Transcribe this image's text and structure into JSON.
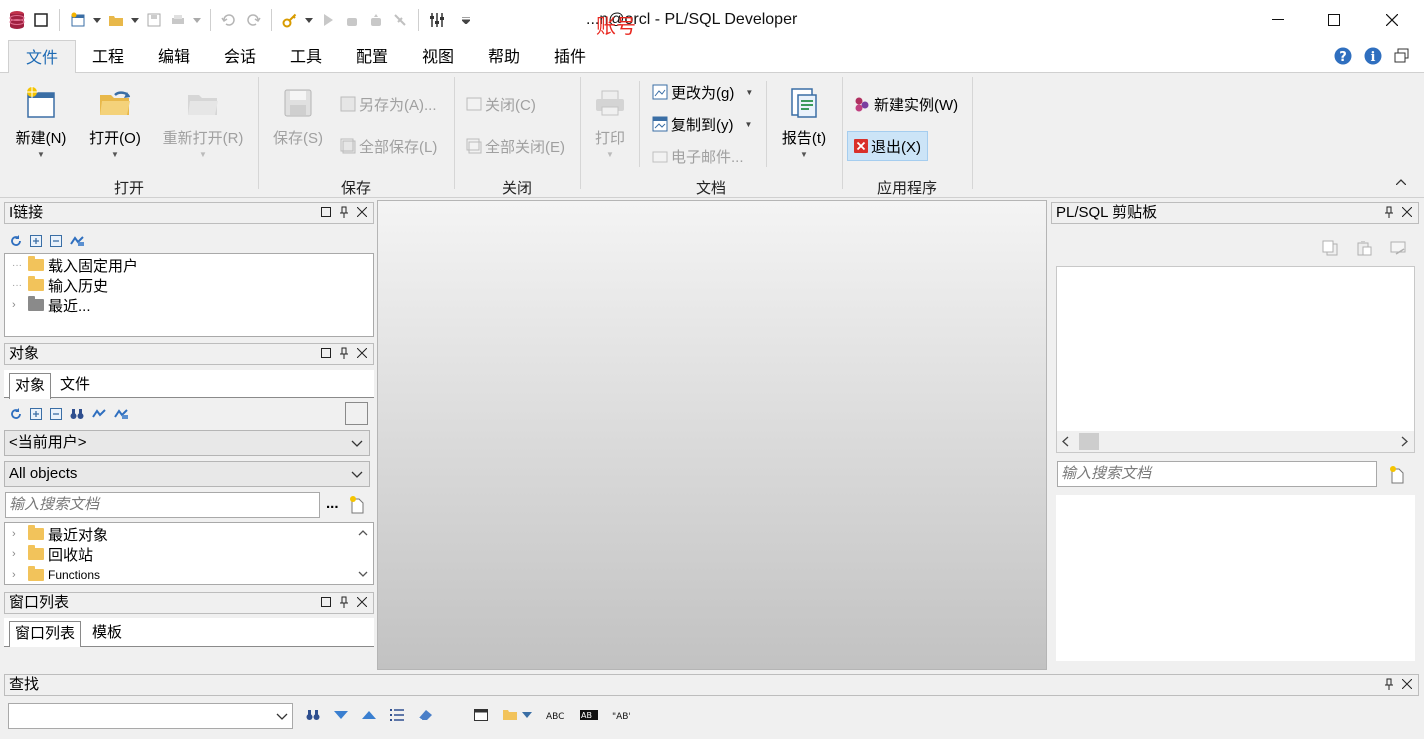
{
  "window": {
    "title_prefix": "...",
    "title_suffix": "n@orcl - PL/SQL Developer",
    "title_overlay": "账号"
  },
  "menu": [
    "文件",
    "工程",
    "编辑",
    "会话",
    "工具",
    "配置",
    "视图",
    "帮助",
    "插件"
  ],
  "ribbon": {
    "new": "新建(N)",
    "open": "打开(O)",
    "reopen": "重新打开(R)",
    "group_open": "打开",
    "save": "保存(S)",
    "save_as": "另存为(A)...",
    "save_all": "全部保存(L)",
    "group_save": "保存",
    "close": "关闭(C)",
    "close_all": "全部关闭(E)",
    "group_close": "关闭",
    "print": "打印",
    "change_to": "更改为(g)",
    "copy_to": "复制到(y)",
    "email": "电子邮件...",
    "report": "报告(t)",
    "group_doc": "文档",
    "new_instance": "新建实例(W)",
    "exit": "退出(X)",
    "group_app": "应用程序"
  },
  "connection_panel": {
    "title": "I链接",
    "items": [
      "载入固定用户",
      "输入历史",
      "最近..."
    ]
  },
  "object_panel": {
    "title": "对象",
    "tabs": [
      "对象",
      "文件"
    ],
    "user_combo": "<当前用户>",
    "filter_combo": "All objects",
    "search_placeholder": "输入搜索文档",
    "more": "...",
    "items": [
      "最近对象",
      "回收站",
      "Functions"
    ]
  },
  "window_list_panel": {
    "title": "窗口列表",
    "tabs": [
      "窗口列表",
      "模板"
    ]
  },
  "clipboard_panel": {
    "title": "PL/SQL 剪贴板",
    "search_placeholder": "输入搜索文档"
  },
  "find_panel": {
    "title": "查找"
  },
  "colors": {
    "accent": "#1d6ab4",
    "overlay_red": "#e8271f",
    "exit_bg": "#cce4f7"
  }
}
